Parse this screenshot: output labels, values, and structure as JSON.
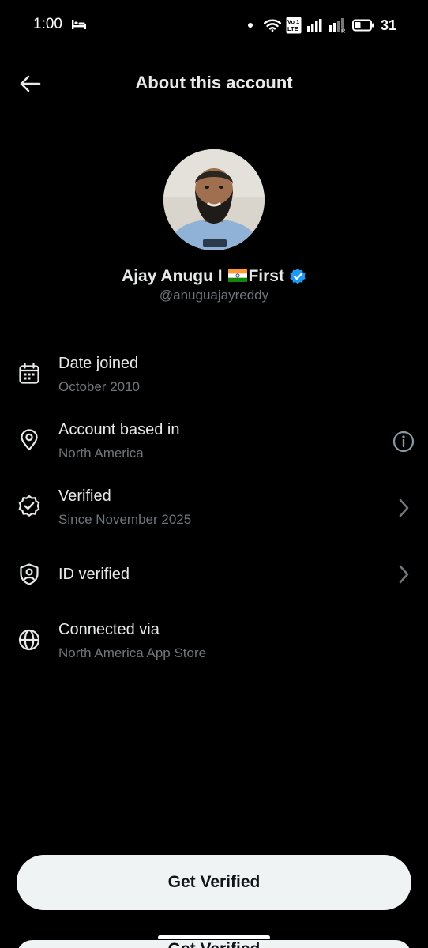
{
  "status_bar": {
    "time": "1:00",
    "battery": "31",
    "icons": [
      "bed-icon",
      "wifi-icon",
      "volte-icon",
      "signal-icon",
      "signal-roaming-icon",
      "battery-icon"
    ]
  },
  "header": {
    "back_icon": "arrow-left-icon",
    "title": "About this account"
  },
  "profile": {
    "name_prefix": "Ajay Anugu I ",
    "name_suffix": "First",
    "flag": "india-flag-icon",
    "verified_badge": "verified-badge-icon",
    "handle": "@anuguajayreddy"
  },
  "info": [
    {
      "icon": "calendar-icon",
      "title": "Date joined",
      "subtitle": "October 2010",
      "right_icon": ""
    },
    {
      "icon": "location-pin-icon",
      "title": "Account based in",
      "subtitle": "North America",
      "right_icon": "info-icon"
    },
    {
      "icon": "verified-outline-icon",
      "title": "Verified",
      "subtitle": "Since November 2025",
      "right_icon": "chevron-right-icon"
    },
    {
      "icon": "id-shield-icon",
      "title": "ID verified",
      "subtitle": "",
      "right_icon": "chevron-right-icon"
    },
    {
      "icon": "globe-icon",
      "title": "Connected via",
      "subtitle": "North America App Store",
      "right_icon": ""
    }
  ],
  "actions": {
    "get_verified": "Get Verified"
  },
  "colors": {
    "background": "#000000",
    "primary_text": "#e7e9ea",
    "secondary_text": "#71767b",
    "verified_blue": "#1d9bf0",
    "button_bg": "#eff3f4"
  }
}
